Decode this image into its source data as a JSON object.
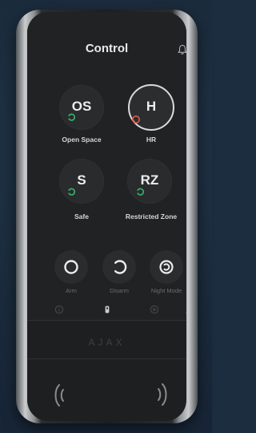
{
  "header": {
    "title": "Control"
  },
  "zones": [
    {
      "code": "OS",
      "name": "Open Space",
      "status": "disarmed",
      "selected": false
    },
    {
      "code": "H",
      "name": "HR",
      "status": "alarm",
      "selected": true
    },
    {
      "code": "S",
      "name": "Safe",
      "status": "disarmed",
      "selected": false
    },
    {
      "code": "RZ",
      "name": "Restricted Zone",
      "status": "disarmed",
      "selected": false
    }
  ],
  "modes": [
    {
      "label": "Arm",
      "icon": "arm-icon"
    },
    {
      "label": "Disarm",
      "icon": "disarm-icon"
    },
    {
      "label": "Night Mode",
      "icon": "night-mode-icon"
    }
  ],
  "nav": [
    {
      "icon": "info-icon"
    },
    {
      "icon": "keypad-icon",
      "active": true
    },
    {
      "icon": "alarm-icon"
    },
    {
      "icon": "user-icon"
    }
  ],
  "device": {
    "brand": "AJAX",
    "nfc_icon": "contactless-icon"
  },
  "colors": {
    "disarmed_status": "#39b36f",
    "alarm_status": "#e05a4b",
    "background": "#1c2d3f"
  }
}
